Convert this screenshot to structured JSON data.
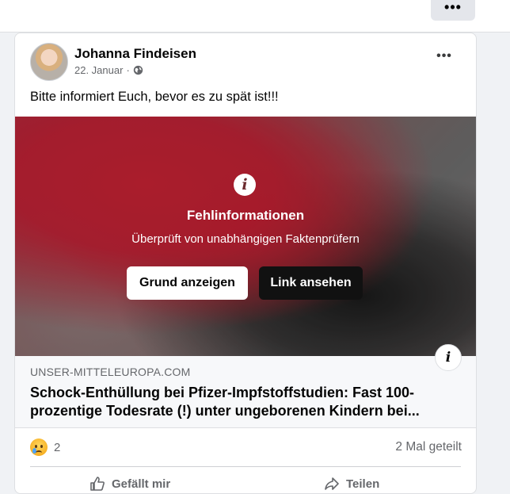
{
  "topbar": {
    "more_label": "•••"
  },
  "post": {
    "author": "Johanna Findeisen",
    "date": "22. Januar",
    "date_separator": "·",
    "more_label": "•••",
    "text": "Bitte informiert Euch, bevor es zu spät ist!!!",
    "warning": {
      "info_glyph": "i",
      "title": "Fehlinformationen",
      "subtitle": "Überprüft von unabhängigen Faktenprüfern",
      "reason_button": "Grund anzeigen",
      "link_button": "Link ansehen"
    },
    "link": {
      "info_glyph": "i",
      "domain": "UNSER-MITTELEUROPA.COM",
      "title": "Schock-Enthüllung bei Pfizer-Impfstoffstudien: Fast 100-prozentige Todesrate (!) unter ungeborenen Kindern bei..."
    },
    "reactions": {
      "count": "2",
      "icon": "sad-emoji-icon"
    },
    "shares": "2 Mal geteilt",
    "actions": {
      "like": "Gefällt mir",
      "share": "Teilen"
    }
  },
  "colors": {
    "button_dark": "#111111",
    "meta_gray": "#65676b",
    "background": "#f0f2f5"
  }
}
